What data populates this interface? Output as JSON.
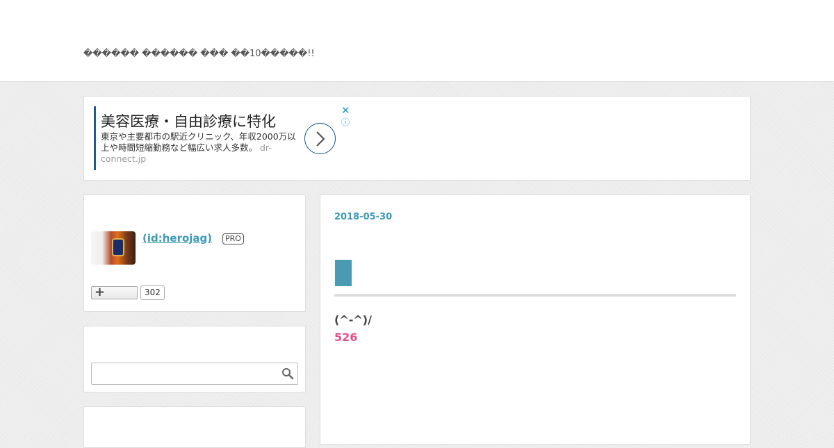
{
  "header": {
    "description": "������ ������ ��� ��10�����!!"
  },
  "ad": {
    "title": "美容医療・自由診療に特化",
    "text": "東京や主要都市の駅近クリニック、年収2000万以上や時間短縮勤務など幅広い求人多数。",
    "domain": "dr-connect.jp",
    "close_label": "✕",
    "info_label": "ⓘ",
    "accent": "#1a5a96"
  },
  "profile": {
    "name": " (id:herojag)",
    "badge": "PRO",
    "follow_plus": "+",
    "follower_count": "302"
  },
  "search": {
    "value": "",
    "placeholder": ""
  },
  "article": {
    "date": "2018-05-30",
    "text": "(^-^)/",
    "number": "526",
    "accent": "#3d9bb7",
    "number_color": "#e4508a"
  }
}
